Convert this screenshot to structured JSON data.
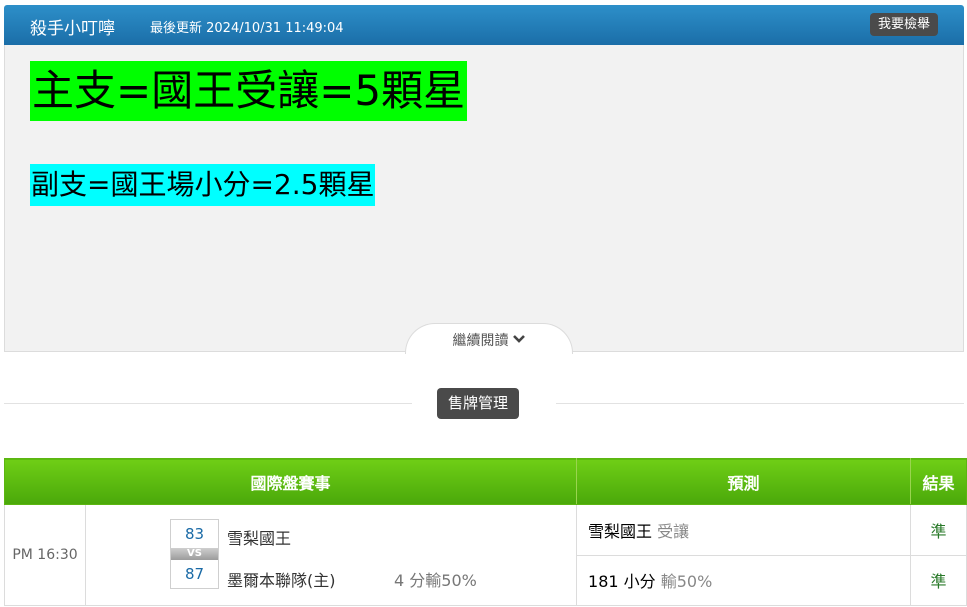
{
  "header": {
    "author": "殺手小叮嚀",
    "last_updated": "最後更新 2024/10/31 11:49:04",
    "report_button": "我要檢舉"
  },
  "article": {
    "line1": "主支=國王受讓=5顆星",
    "line1_bg": "#00ff00",
    "line2": "副支=國王場小分=2.5顆星",
    "line2_bg": "#00ffff",
    "read_more": "繼續閱讀"
  },
  "section": {
    "tab_label": "售牌管理"
  },
  "table": {
    "headers": {
      "match": "國際盤賽事",
      "prediction": "預測",
      "result": "結果"
    },
    "rows": [
      {
        "time": "PM 16:30",
        "away_score": "83",
        "vs": "VS",
        "home_score": "87",
        "away_team": "雪梨國王",
        "home_team": "墨爾本聯隊(主)",
        "handicap": "4 分輸50%",
        "predictions": [
          {
            "pick": "雪梨國王",
            "type": "受讓",
            "result": "準"
          },
          {
            "pick": "181 小分",
            "type": "輸50%",
            "result": "準"
          }
        ]
      }
    ]
  },
  "colors": {
    "header_blue": "#1b6ea8",
    "table_header_green": "#5cb611",
    "score_blue": "#1a6aa6",
    "result_green": "#2a7a2a"
  },
  "icons": {
    "read_more": "chevron-down-icon"
  }
}
